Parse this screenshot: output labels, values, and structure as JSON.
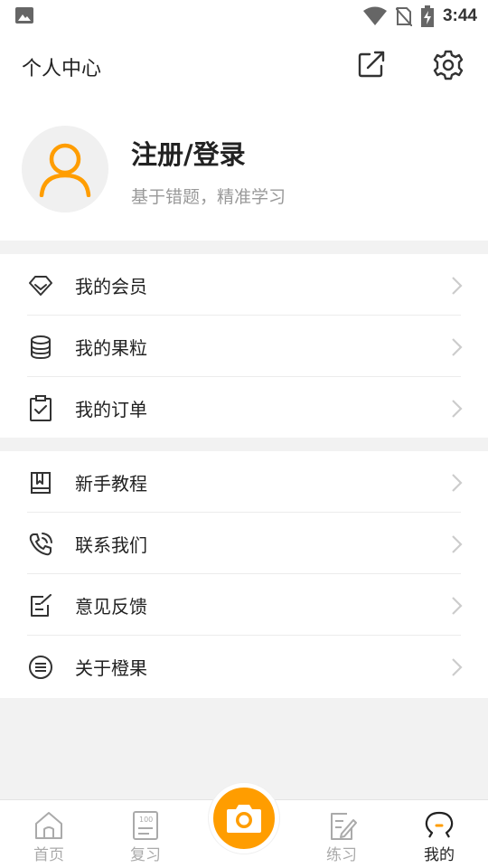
{
  "status_bar": {
    "time": "3:44",
    "icons": [
      "image-icon",
      "wifi-icon",
      "no-sim-icon",
      "battery-charging-icon"
    ]
  },
  "header": {
    "title": "个人中心",
    "actions": [
      "share-icon",
      "settings-gear-icon"
    ]
  },
  "profile": {
    "name": "注册/登录",
    "subtitle": "基于错题，精准学习",
    "avatar_icon": "user-avatar-icon"
  },
  "menu_group_1": [
    {
      "label": "我的会员",
      "icon": "diamond-icon"
    },
    {
      "label": "我的果粒",
      "icon": "coin-stack-icon"
    },
    {
      "label": "我的订单",
      "icon": "clipboard-check-icon"
    }
  ],
  "menu_group_2": [
    {
      "label": "新手教程",
      "icon": "book-icon"
    },
    {
      "label": "联系我们",
      "icon": "phone-icon"
    },
    {
      "label": "意见反馈",
      "icon": "feedback-edit-icon"
    },
    {
      "label": "关于橙果",
      "icon": "list-circle-icon"
    }
  ],
  "tabbar": {
    "home": "首页",
    "review": "复习",
    "camera_icon": "camera-icon",
    "practice": "练习",
    "mine": "我的",
    "active": "mine"
  },
  "colors": {
    "accent": "#ff9d00",
    "text": "#222222",
    "subtext": "#999999",
    "background": "#f2f2f2"
  }
}
